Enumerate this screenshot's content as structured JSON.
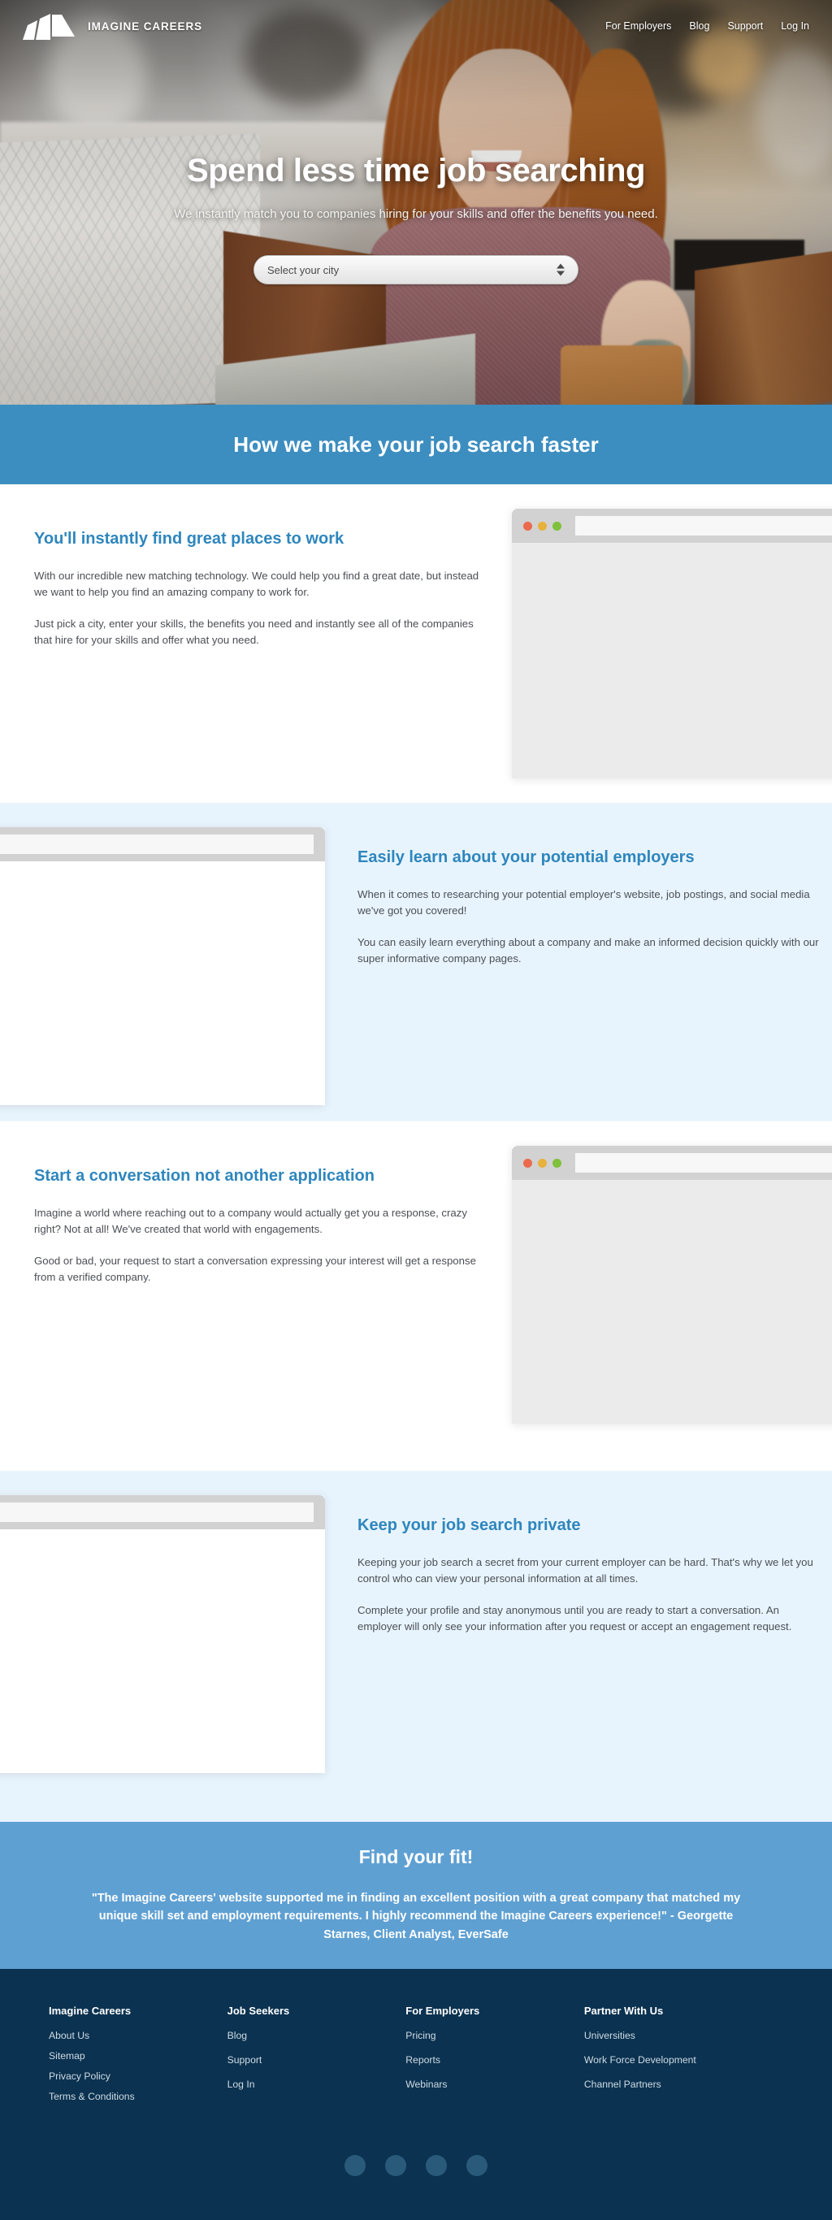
{
  "brand": {
    "name": "IMAGINE CAREERS",
    "logo_icon": "mountain-logo-icon"
  },
  "nav": {
    "links": [
      {
        "label": "For Employers"
      },
      {
        "label": "Blog"
      },
      {
        "label": "Support"
      },
      {
        "label": "Log In"
      }
    ]
  },
  "hero": {
    "title": "Spend less time job searching",
    "subtitle": "We instantly match you to companies hiring for your skills and offer the benefits you need.",
    "city_select": {
      "value": "Select your city",
      "stepper_icon": "up-down-stepper-icon"
    }
  },
  "banner": {
    "title": "How we make your job search faster"
  },
  "features": [
    {
      "title": "You'll instantly find great places to work",
      "paragraphs": [
        "With our incredible new matching technology. We could help you find a great date, but instead we want to help you find an amazing company to work for.",
        "Just pick a city, enter your skills, the benefits you need and instantly see all of the companies that hire for your skills and offer what you need."
      ],
      "mockup": {
        "side": "right",
        "body": "gray"
      }
    },
    {
      "title": "Easily learn about your potential employers",
      "paragraphs": [
        "When it comes to researching your potential employer's website, job postings, and social media we've got you covered!",
        "You can easily learn everything about a company and make an informed decision quickly with our super informative company pages."
      ],
      "mockup": {
        "side": "left",
        "body": "white"
      }
    },
    {
      "title": "Start a conversation not another application",
      "paragraphs": [
        "Imagine a world where reaching out to a company would actually get you a response, crazy right? Not at all! We've created that world with engagements.",
        "Good or bad, your request to start a conversation expressing your interest will get a response from a verified company."
      ],
      "mockup": {
        "side": "right",
        "body": "gray"
      }
    },
    {
      "title": "Keep your job search private",
      "paragraphs": [
        "Keeping your job search a secret from your current employer can be hard. That's why we let you control who can view your personal information at all times.",
        "Complete your profile and stay anonymous until you are ready to start a conversation. An employer will only see your information after you request or accept an engagement request."
      ],
      "mockup": {
        "side": "left",
        "body": "white"
      }
    }
  ],
  "testimonial": {
    "title": "Find your fit!",
    "quote": "\"The Imagine Careers' website supported me in finding an excellent position with a great company that matched my unique skill set and employment requirements. I highly recommend the Imagine Careers experience!\" - Georgette Starnes, Client Analyst, EverSafe"
  },
  "footer": {
    "columns": [
      {
        "title": "Imagine Careers",
        "links": [
          {
            "label": "About Us"
          },
          {
            "label": "Sitemap"
          },
          {
            "label": "Privacy Policy"
          },
          {
            "label": "Terms & Conditions"
          }
        ]
      },
      {
        "title": "Job Seekers",
        "links": [
          {
            "label": "Blog"
          },
          {
            "label": "Support"
          },
          {
            "label": "Log In"
          }
        ]
      },
      {
        "title": "For Employers",
        "links": [
          {
            "label": "Pricing"
          },
          {
            "label": "Reports"
          },
          {
            "label": "Webinars"
          }
        ]
      },
      {
        "title": "Partner With Us",
        "links": [
          {
            "label": "Universities"
          },
          {
            "label": "Work Force Development"
          },
          {
            "label": "Channel Partners"
          }
        ]
      }
    ],
    "social": [
      {
        "icon": "social-circle-icon-1"
      },
      {
        "icon": "social-circle-icon-2"
      },
      {
        "icon": "social-circle-icon-3"
      },
      {
        "icon": "social-circle-icon-4"
      }
    ]
  },
  "colors": {
    "brand_blue": "#3d8ec0",
    "heading_blue": "#2e86bd",
    "tint_bg": "#e8f4fd",
    "testimonial_bg": "#5fa0d3",
    "footer_bg": "#0b3250",
    "social_dot": "#2a5a7a"
  }
}
